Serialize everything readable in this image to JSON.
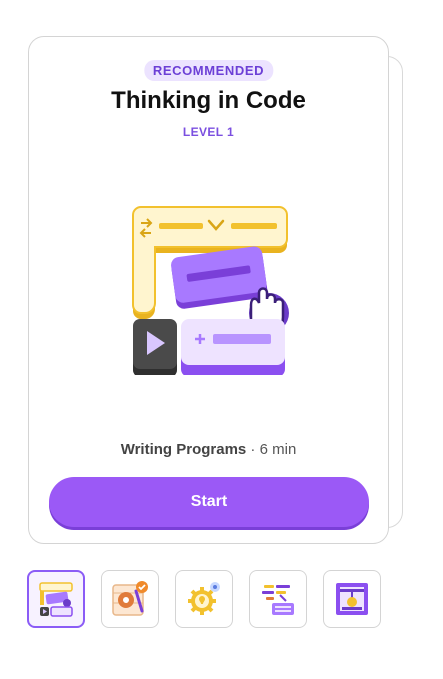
{
  "card": {
    "badge": "RECOMMENDED",
    "title": "Thinking in Code",
    "level": "LEVEL 1",
    "category": "Writing Programs",
    "separator": " · ",
    "duration": "6 min",
    "start_label": "Start",
    "illustration_icon": "code-blocks-illustration"
  },
  "thumbnails": [
    {
      "icon": "code-blocks-icon",
      "active": true
    },
    {
      "icon": "wheel-checkmark-icon",
      "active": false
    },
    {
      "icon": "gear-lightbulb-icon",
      "active": false
    },
    {
      "icon": "data-sorting-icon",
      "active": false
    },
    {
      "icon": "3d-printer-icon",
      "active": false
    }
  ],
  "colors": {
    "accent": "#9b59f6",
    "badge_bg": "#ece3ff",
    "badge_text": "#6c3fd6",
    "yellow": "#f2c12e"
  }
}
